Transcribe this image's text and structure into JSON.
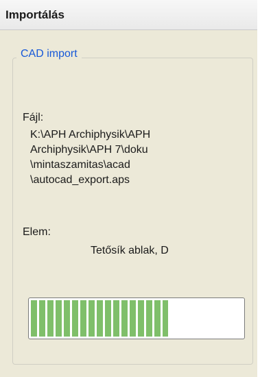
{
  "window": {
    "title": "Importálás"
  },
  "group": {
    "legend": "CAD import"
  },
  "file": {
    "label": "Fájl:",
    "path_lines": [
      "K:\\APH Archiphysik\\APH",
      "Archiphysik\\APH 7\\doku",
      "\\mintaszamitas\\acad",
      "\\autocad_export.aps"
    ]
  },
  "element": {
    "label": "Elem:",
    "value": "Tetősík ablak, D"
  },
  "progress": {
    "percent": 65,
    "fill_color": "#7fbf6a"
  }
}
